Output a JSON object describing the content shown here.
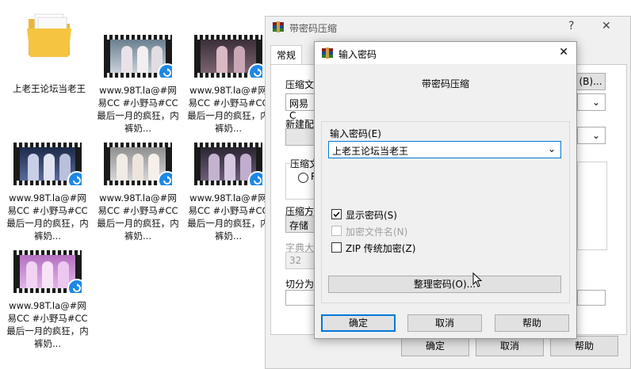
{
  "desktop": {
    "folder": {
      "label": "上老王论坛当老王"
    },
    "files": [
      {
        "label": "www.98T.la@#网易CC #小野马#CC 最后一月的疯狂，内裤奶..."
      },
      {
        "label": "www.98T.la@#网易CC #小野马#CC 最后一月的疯狂，内裤奶..."
      },
      {
        "label": "www.98T.la@#网易CC #小野马#CC 最后一月的疯狂，内裤奶..."
      },
      {
        "label": "www.98T.la@#网易CC #小野马#CC 最后一月的疯狂，内裤奶..."
      },
      {
        "label": "www.98T.la@#网易CC #小野马#CC 最后一月的疯狂，内裤奶..."
      },
      {
        "label": "www.98T.la@#网易CC #小野马#CC 最后一月的疯狂，内裤奶..."
      },
      {
        "label": "www.98T.la@#网易CC #小野马#CC 最后一月的疯狂，内裤奶..."
      }
    ]
  },
  "main_dialog": {
    "title": "带密码压缩",
    "help_btn": "?",
    "close_btn": "✕",
    "tab": "常规",
    "label_archive": "压缩文",
    "archive_value": "网易C",
    "browse_btn": "(B)...",
    "label_profile": "新建配",
    "label_format": "压缩文",
    "radio_partial": "R",
    "label_method": "压缩方",
    "method_value": "存储",
    "label_dict": "字典大",
    "dict_value": "32",
    "label_split": "切分为",
    "ok": "确定",
    "cancel": "取消",
    "help": "帮助"
  },
  "password_dialog": {
    "title": "输入密码",
    "close_btn": "✕",
    "heading": "带密码压缩",
    "label_password": "输入密码(E)",
    "password_value": "上老王论坛当老王",
    "show_password": "显示密码(S)",
    "encrypt_names": "加密文件名(N)",
    "zip_legacy": "ZIP 传统加密(Z)",
    "organize_btn": "整理密码(O)...",
    "ok": "确定",
    "cancel": "取消",
    "help": "帮助"
  },
  "colors": {
    "accent": "#0078d7",
    "badge": "#1e88e5",
    "folder": "#f5c542"
  }
}
